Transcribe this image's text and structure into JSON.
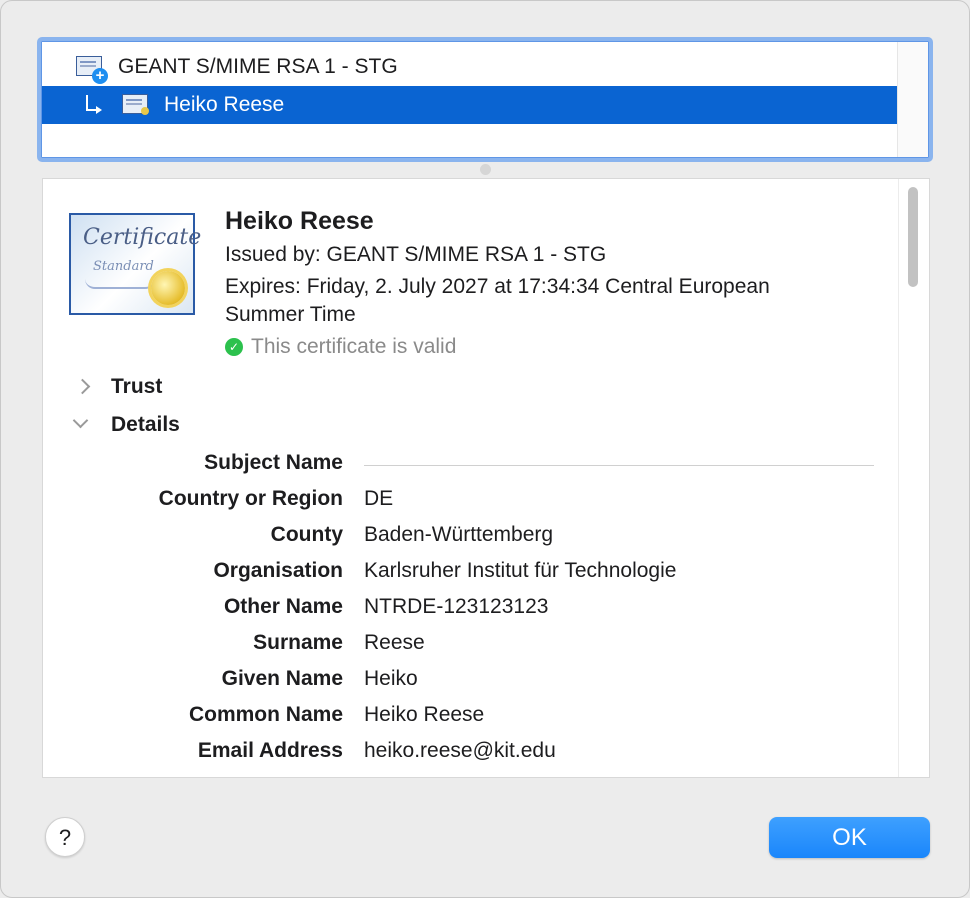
{
  "chain": {
    "items": [
      {
        "label": "GEANT S/MIME RSA 1 - STG",
        "icon": "certificate-authority-icon"
      },
      {
        "label": "Heiko Reese",
        "icon": "certificate-icon",
        "selected": true
      }
    ]
  },
  "certificate": {
    "image_text": {
      "title": "Certificate",
      "subtitle": "Standard"
    },
    "name": "Heiko Reese",
    "issued_by": "Issued by: GEANT S/MIME RSA 1 - STG",
    "expires_line1": "Expires: Friday, 2. July 2027 at 17:34:34 Central European",
    "expires_line2": "Summer Time",
    "valid_text": "This certificate is valid",
    "valid_color": "#2cc14d"
  },
  "sections": {
    "trust": "Trust",
    "details": "Details"
  },
  "details": {
    "subject_name": "Subject Name",
    "rows": [
      {
        "label": "Country or Region",
        "value": "DE"
      },
      {
        "label": "County",
        "value": "Baden-Württemberg"
      },
      {
        "label": "Organisation",
        "value": "Karlsruher Institut für Technologie"
      },
      {
        "label": "Other Name",
        "value": "NTRDE-123123123"
      },
      {
        "label": "Surname",
        "value": "Reese"
      },
      {
        "label": "Given Name",
        "value": "Heiko"
      },
      {
        "label": "Common Name",
        "value": "Heiko Reese"
      },
      {
        "label": "Email Address",
        "value": "heiko.reese@kit.edu"
      }
    ]
  },
  "buttons": {
    "help": "?",
    "ok": "OK"
  },
  "colors": {
    "selection": "#0a64d2",
    "accent": "#1a86fb"
  }
}
